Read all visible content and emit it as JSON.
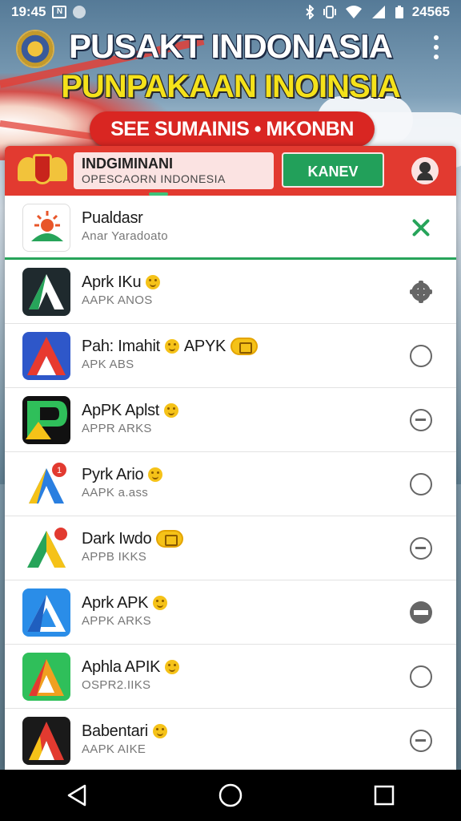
{
  "status_bar": {
    "time": "19:45",
    "notif_box": "N",
    "right_text": "24565"
  },
  "header": {
    "title_line1": "PUSAKT INDONASIA",
    "title_line2": "PUNPAKAAN INOINSIA",
    "ribbon": "SEE SUMAINIS • MKONBN"
  },
  "banner": {
    "title": "INDGIMINANI",
    "subtitle": "OPESCAORN INDONESIA",
    "button_label": "KANEV"
  },
  "apps": [
    {
      "title": "Pualdasr",
      "subtitle": "Anar Yaradoato",
      "action": "close",
      "badge": "none",
      "icon": "sun-logo-icon"
    },
    {
      "title": "Aprk IKu",
      "subtitle": "AAPK ANOS",
      "action": "gear",
      "badge": "emoji",
      "icon": "apk-a-dark-icon"
    },
    {
      "title": "Pah: Imahit",
      "title_suffix": "APYK",
      "subtitle": "APK ABS",
      "action": "circle",
      "badge": "emoji+pill",
      "icon": "apk-a-red-icon"
    },
    {
      "title": "ApPK Aplst",
      "subtitle": "APPR ARKS",
      "action": "minus",
      "badge": "emoji",
      "icon": "apk-p-green-icon"
    },
    {
      "title": "Pyrk Ario",
      "subtitle": "AAPK a.ass",
      "action": "circle",
      "badge": "emoji",
      "icon": "apk-a-blue-icon"
    },
    {
      "title": "Dark Iwdo",
      "subtitle": "APPB IKKS",
      "action": "minus",
      "badge": "pill",
      "icon": "apk-a-multicolor-icon"
    },
    {
      "title": "Aprk APK",
      "subtitle": "APPK ARKS",
      "action": "gear2",
      "badge": "emoji",
      "icon": "apk-a-blue-triangle-icon"
    },
    {
      "title": "Aphla APIK",
      "subtitle": "OSPR2.IIKS",
      "action": "circle",
      "badge": "emoji",
      "icon": "apk-a-green-icon"
    },
    {
      "title": "Babentari",
      "subtitle": "AAPK AIKE",
      "action": "minus",
      "badge": "emoji",
      "icon": "apk-a-black-icon"
    }
  ],
  "colors": {
    "banner_red": "#e23a30",
    "button_green": "#22a05a",
    "ribbon_red": "#d92622",
    "title_yellow": "#f5e21a"
  }
}
